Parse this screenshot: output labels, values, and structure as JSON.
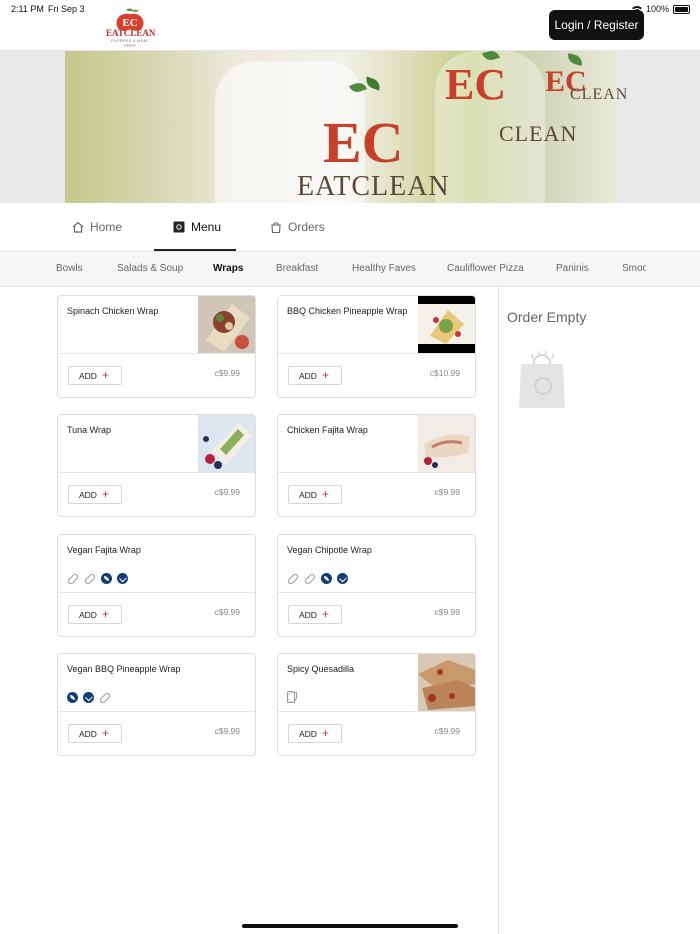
{
  "status_bar": {
    "time": "2:11 PM",
    "date": "Fri Sep 3",
    "battery": "100%"
  },
  "brand": {
    "logo_initials": "EC",
    "name": "EATCLEAN",
    "tagline": "EXPRESS & MEAL PREP"
  },
  "header": {
    "login_label": "Login / Register"
  },
  "nav": {
    "home": "Home",
    "menu": "Menu",
    "orders": "Orders"
  },
  "categories": [
    "Bowls",
    "Salads & Soup",
    "Wraps",
    "Breakfast",
    "Healthy Faves",
    "Cauliflower Pizza",
    "Paninis",
    "Smoo"
  ],
  "active_category": "Wraps",
  "add_label": "ADD",
  "products": [
    {
      "name": "Spinach Chicken Wrap",
      "price": "c$9.99"
    },
    {
      "name": "BBQ Chicken Pineapple Wrap",
      "price": "c$10.99"
    },
    {
      "name": "Tuna Wrap",
      "price": "c$9.99"
    },
    {
      "name": "Chicken Fajita Wrap",
      "price": "c$9.99"
    },
    {
      "name": "Vegan Fajita Wrap",
      "price": "c$9.99"
    },
    {
      "name": "Vegan Chipotle Wrap",
      "price": "c$9.99"
    },
    {
      "name": "Vegan BBQ Pineapple Wrap",
      "price": "c$9.99"
    },
    {
      "name": "Spicy Quesadilla",
      "price": "c$9.99"
    }
  ],
  "order": {
    "empty_label": "Order Empty"
  },
  "colors": {
    "accent": "#d32f2f",
    "badge": "#123d73",
    "button_dark": "#111111"
  }
}
